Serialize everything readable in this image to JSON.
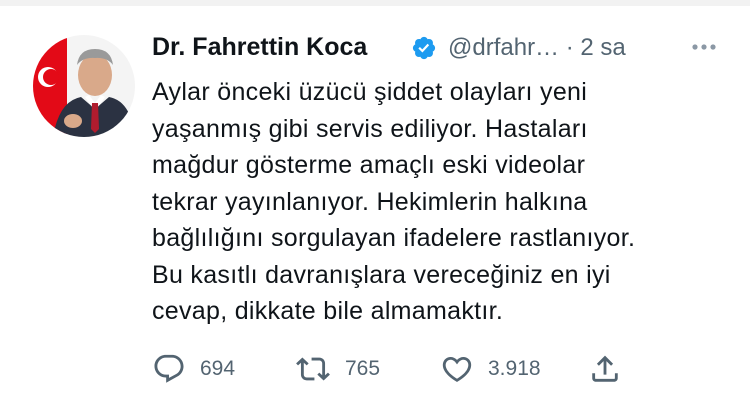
{
  "tweet": {
    "author_name": "Dr. Fahrettin Koca",
    "handle": "@drfahr…",
    "separator": "·",
    "time": "2 sa",
    "verified": true,
    "lines": [
      "Aylar önceki üzücü şiddet olayları yeni",
      "yaşanmış gibi servis ediliyor. Hastaları",
      "mağdur gösterme amaçlı eski videolar",
      "tekrar yayınlanıyor. Hekimlerin halkına",
      "bağlılığını sorgulayan ifadelere rastlanıyor.",
      "Bu kasıtlı davranışlara vereceğiniz en iyi",
      "cevap, dikkate bile almamaktır."
    ]
  },
  "actions": {
    "reply": {
      "icon": "reply-icon",
      "count": "694"
    },
    "retweet": {
      "icon": "retweet-icon",
      "count": "765"
    },
    "like": {
      "icon": "heart-icon",
      "count": "3.918"
    },
    "share": {
      "icon": "share-icon"
    }
  },
  "colors": {
    "text": "#0f1419",
    "muted": "#536471",
    "verified": "#1d9bf0",
    "flag_red": "#e30a17"
  }
}
